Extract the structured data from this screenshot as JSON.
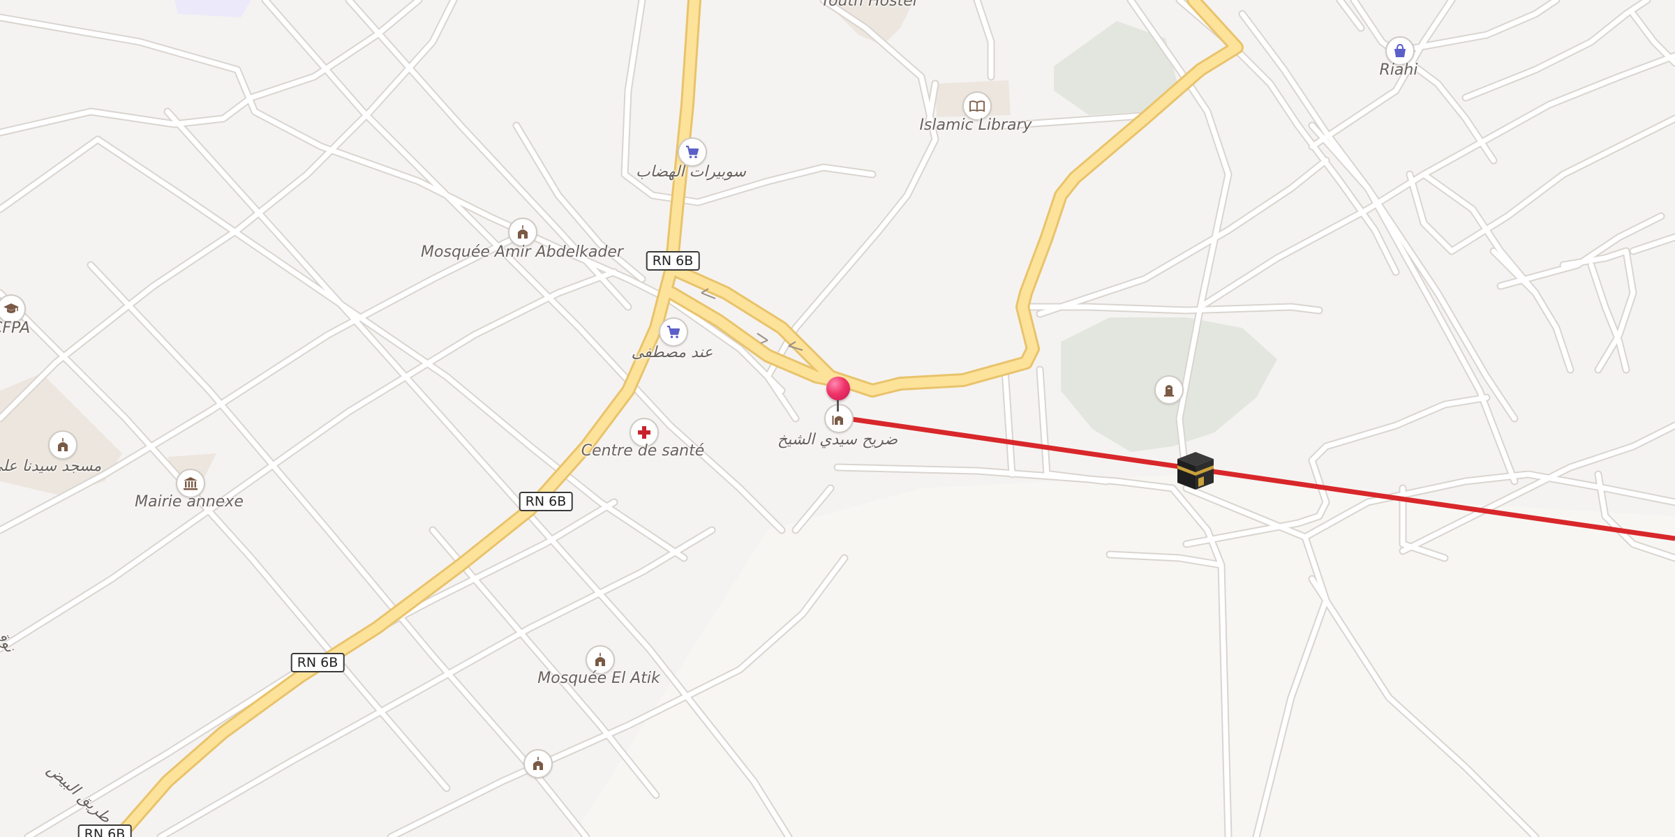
{
  "map": {
    "colors": {
      "background": "#f5f3f1",
      "road": "#ffffff",
      "road_casing": "#d9d4cf",
      "highway": "#fde29a",
      "highway_casing": "#e9c36b",
      "park": "#e3e6df",
      "building": "#ece6df",
      "qibla_line": "#d8272a",
      "poi_icon_brown": "#7a5a45",
      "poi_icon_blue": "#5b5fc7",
      "poi_icon_red": "#c8232c"
    },
    "road_shields": [
      {
        "id": "rn6b-1",
        "label": "RN 6B"
      },
      {
        "id": "rn6b-2",
        "label": "RN 6B"
      },
      {
        "id": "rn6b-3",
        "label": "RN 6B"
      },
      {
        "id": "rn6b-4",
        "label": "RN 6B"
      }
    ],
    "pois": {
      "soup_top": {
        "icon": "shopping-cart-icon",
        "label": "سوبيرات الهضاب"
      },
      "soup_mid": {
        "icon": "shopping-cart-icon",
        "label": "عند مصطفى"
      },
      "mosquee_amir": {
        "icon": "mosque-icon",
        "label": "Mosquée Amir Abdelkader"
      },
      "islamic_library": {
        "icon": "book-icon",
        "label": "Islamic Library"
      },
      "riahi": {
        "icon": "shopping-bag-icon",
        "label": "Riahi"
      },
      "cfpa": {
        "icon": "graduation-cap-icon",
        "label": "CFPA"
      },
      "mosque_sidna_ali": {
        "icon": "mosque-icon",
        "label": "مسجد سيدنا علي"
      },
      "mairie_annexe": {
        "icon": "town-hall-icon",
        "label": "Mairie annexe"
      },
      "centre_sante": {
        "icon": "medical-cross-icon",
        "label": "Centre de santé"
      },
      "darih_sidi_cheikh": {
        "icon": "mausoleum-icon",
        "label": "ضريح سيدي الشيخ"
      },
      "cemetery": {
        "icon": "tombstone-icon",
        "label": ""
      },
      "mosquee_el_atik": {
        "icon": "mosque-icon",
        "label": "Mosquée El Atik"
      },
      "mosque_bottom": {
        "icon": "mosque-icon",
        "label": ""
      }
    },
    "partial_labels": {
      "top_cut": "Youth Hostel",
      "left_street": "طريق البيض",
      "left_edge": "نوق"
    },
    "markers": {
      "location_pin": {
        "icon": "location-pin-icon"
      },
      "qibla": {
        "icon": "kaaba-icon"
      }
    }
  }
}
